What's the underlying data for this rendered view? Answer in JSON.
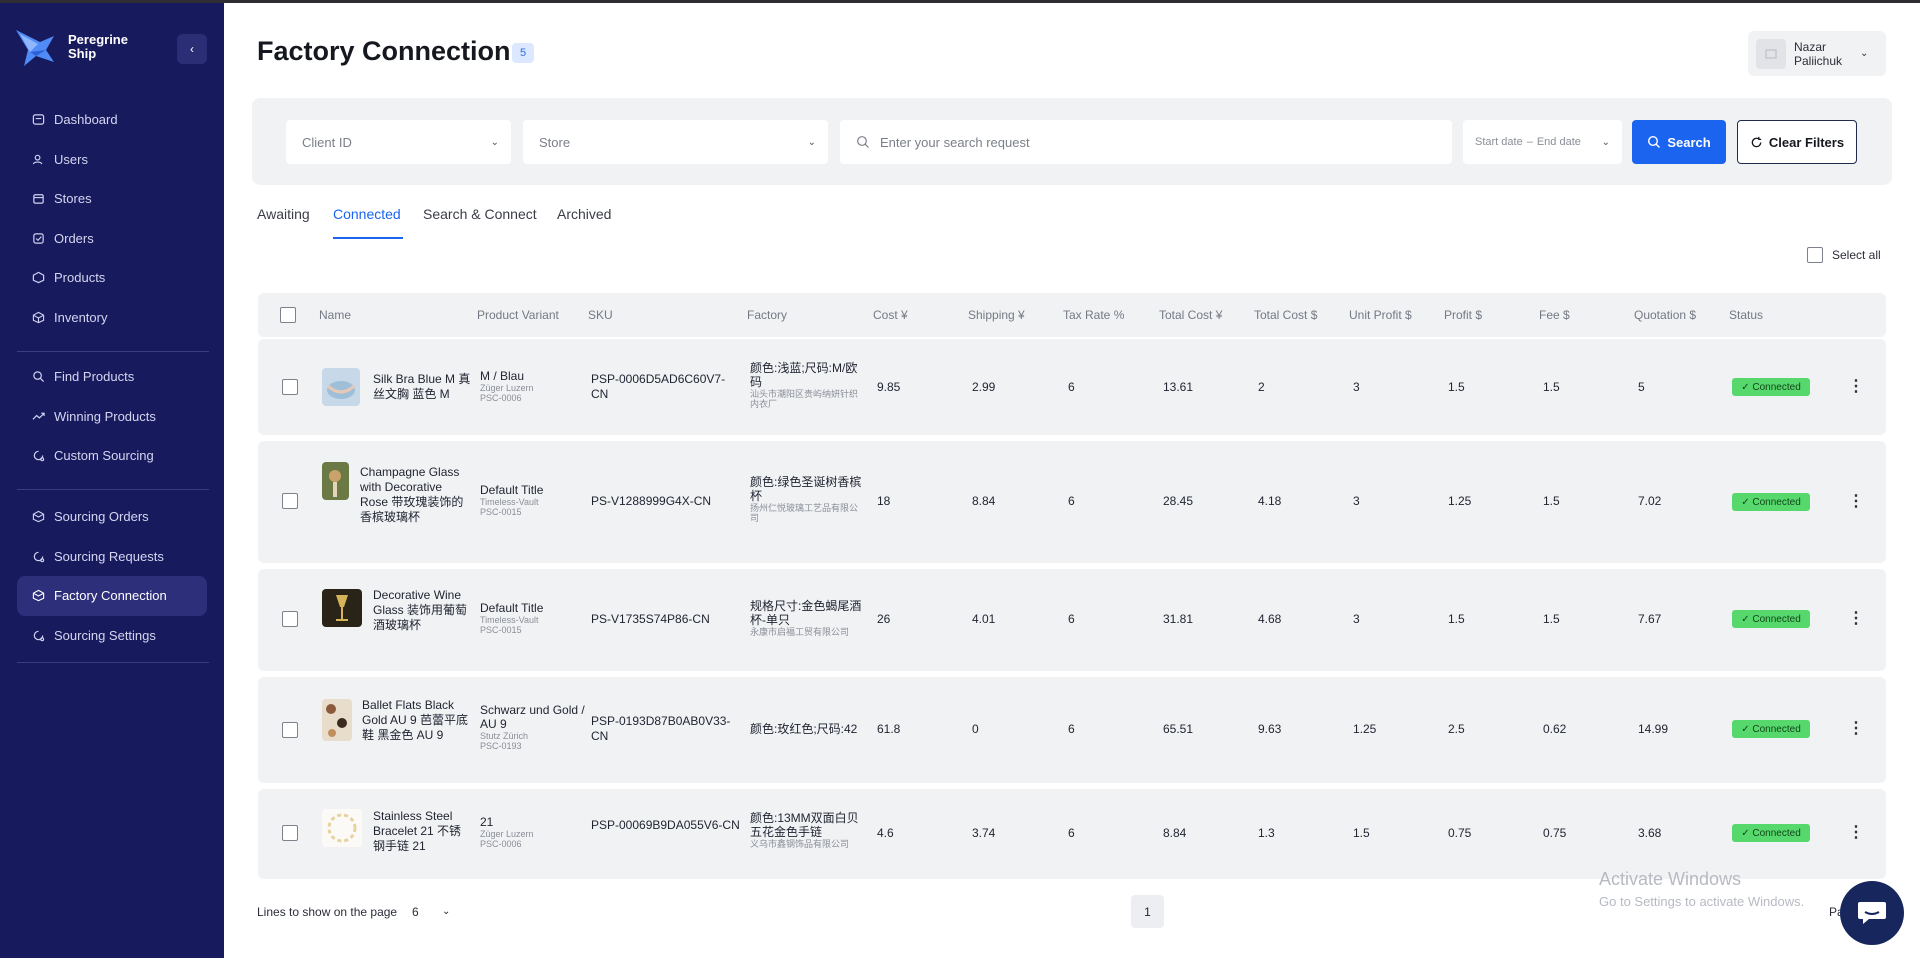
{
  "app": {
    "brand_name": "Peregrine Ship",
    "collapse_icon": "chevron-left-icon"
  },
  "sidebar": {
    "group1": [
      {
        "label": "Dashboard",
        "icon": "dashboard-icon"
      },
      {
        "label": "Users",
        "icon": "users-icon"
      },
      {
        "label": "Stores",
        "icon": "store-icon"
      },
      {
        "label": "Orders",
        "icon": "orders-icon"
      },
      {
        "label": "Products",
        "icon": "products-icon"
      },
      {
        "label": "Inventory",
        "icon": "inventory-icon"
      }
    ],
    "group2": [
      {
        "label": "Find Products",
        "icon": "search-icon"
      },
      {
        "label": "Winning Products",
        "icon": "trend-icon"
      },
      {
        "label": "Custom Sourcing",
        "icon": "sourcing-icon"
      }
    ],
    "group3": [
      {
        "label": "Sourcing Orders",
        "icon": "box-icon"
      },
      {
        "label": "Sourcing Requests",
        "icon": "sourcing-icon"
      },
      {
        "label": "Factory Connection",
        "icon": "box-icon",
        "active": true
      },
      {
        "label": "Sourcing Settings",
        "icon": "sourcing-icon"
      }
    ]
  },
  "header": {
    "title": "Factory Connection",
    "count": "5",
    "user_name": "Nazar Paliichuk"
  },
  "filters": {
    "client_id_placeholder": "Client ID",
    "store_placeholder": "Store",
    "search_placeholder": "Enter your search request",
    "start_date": "Start date",
    "date_sep": "–",
    "end_date": "End date",
    "search_label": "Search",
    "clear_label": "Clear Filters"
  },
  "tabs": [
    {
      "label": "Awaiting"
    },
    {
      "label": "Connected",
      "active": true
    },
    {
      "label": "Search & Connect"
    },
    {
      "label": "Archived"
    }
  ],
  "select_all_label": "Select all",
  "table": {
    "columns": [
      "Name",
      "Product Variant",
      "SKU",
      "Factory",
      "Cost ¥",
      "Shipping ¥",
      "Tax Rate %",
      "Total Cost ¥",
      "Total Cost $",
      "Unit Profit $",
      "Profit $",
      "Fee $",
      "Quotation $",
      "Status"
    ],
    "rows": [
      {
        "name": "Silk Bra Blue M 真丝文胸 蓝色 M",
        "variant": "M / Blau",
        "variant_store": "Züger Luzern",
        "variant_code": "PSC-0006",
        "sku": "PSP-0006D5AD6C60V7-CN",
        "factory": "颜色:浅蓝;尺码:M/欧码",
        "factory_sub": "汕头市潮阳区贵屿纳妍针织内衣厂",
        "cost": "9.85",
        "shipping": "2.99",
        "tax": "6",
        "total_cny": "13.61",
        "total_usd": "2",
        "unit_profit": "3",
        "profit": "1.5",
        "fee": "1.5",
        "quotation": "5",
        "status": "Connected",
        "thumb_color": "#b9d3e6"
      },
      {
        "name": "Champagne Glass with Decorative Rose 带玫瑰装饰的香槟玻璃杯",
        "variant": "Default Title",
        "variant_store": "Timeless-Vault",
        "variant_code": "PSC-0015",
        "sku": "PS-V1288999G4X-CN",
        "factory": "颜色:绿色圣诞树香槟杯",
        "factory_sub": "扬州仁悦玻璃工艺品有限公司",
        "cost": "18",
        "shipping": "8.84",
        "tax": "6",
        "total_cny": "28.45",
        "total_usd": "4.18",
        "unit_profit": "3",
        "profit": "1.25",
        "fee": "1.5",
        "quotation": "7.02",
        "status": "Connected",
        "thumb_color": "#5a6b3c"
      },
      {
        "name": "Decorative Wine Glass 装饰用葡萄酒玻璃杯",
        "variant": "Default Title",
        "variant_store": "Timeless-Vault",
        "variant_code": "PSC-0015",
        "sku": "PS-V1735S74P86-CN",
        "factory": "规格尺寸:金色蝎尾酒杯-单只",
        "factory_sub": "永康市启福工贸有限公司",
        "cost": "26",
        "shipping": "4.01",
        "tax": "6",
        "total_cny": "31.81",
        "total_usd": "4.68",
        "unit_profit": "3",
        "profit": "1.5",
        "fee": "1.5",
        "quotation": "7.67",
        "status": "Connected",
        "thumb_color": "#2a2418"
      },
      {
        "name": "Ballet Flats Black Gold AU 9 芭蕾平底鞋 黑金色 AU 9",
        "variant": "Schwarz und Gold / AU 9",
        "variant_store": "Stutz Zürich",
        "variant_code": "PSC-0193",
        "sku": "PSP-0193D87B0AB0V33-CN",
        "factory": "颜色:玫红色;尺码:42",
        "factory_sub": "",
        "cost": "61.8",
        "shipping": "0",
        "tax": "6",
        "total_cny": "65.51",
        "total_usd": "9.63",
        "unit_profit": "1.25",
        "profit": "2.5",
        "fee": "0.62",
        "quotation": "14.99",
        "status": "Connected",
        "thumb_color": "#8b5a3c"
      },
      {
        "name": "Stainless Steel Bracelet 21 不锈钢手链 21",
        "variant": "21",
        "variant_store": "Züger Luzern",
        "variant_code": "PSC-0006",
        "sku": "PSP-00069B9DA055V6-CN",
        "factory": "颜色:13MM双面白贝五花金色手链",
        "factory_sub": "义乌市鑫钢饰品有限公司",
        "cost": "4.6",
        "shipping": "3.74",
        "tax": "6",
        "total_cny": "8.84",
        "total_usd": "1.3",
        "unit_profit": "1.5",
        "profit": "0.75",
        "fee": "0.75",
        "quotation": "3.68",
        "status": "Connected",
        "thumb_color": "#e7d3a1"
      }
    ]
  },
  "footer": {
    "lines_label": "Lines to show on the page",
    "lines_value": "6",
    "page": "1",
    "page_partial": "Pa",
    "watermark_title": "Activate Windows",
    "watermark_sub": "Go to Settings to activate Windows."
  },
  "colors": {
    "sidebar": "#181a5e",
    "accent": "#1a64f0",
    "status_connected": "#57d86c"
  }
}
